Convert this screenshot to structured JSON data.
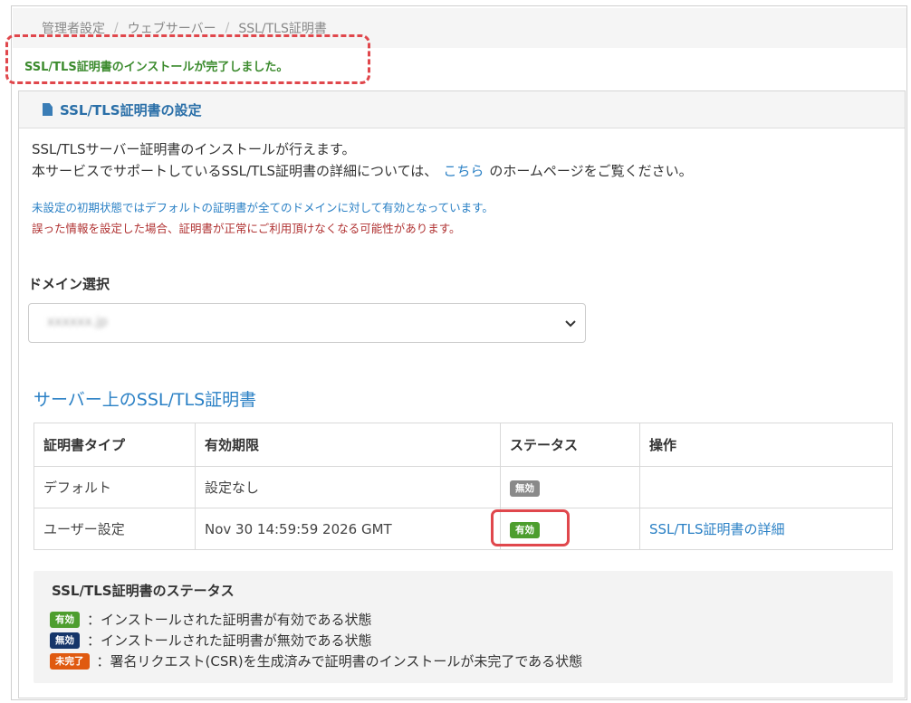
{
  "breadcrumb": [
    "管理者設定",
    "ウェブサーバー",
    "SSL/TLS証明書"
  ],
  "success_message": "SSL/TLS証明書のインストールが完了しました。",
  "panel": {
    "title": "SSL/TLS証明書の設定",
    "intro_line1": "SSL/TLSサーバー証明書のインストールが行えます。",
    "intro_line2_pre": "本サービスでサポートしているSSL/TLS証明書の詳細については、",
    "intro_link": "こちら",
    "intro_line2_post": "のホームページをご覧ください。",
    "note_info": "未設定の初期状態ではデフォルトの証明書が全てのドメインに対して有効となっています。",
    "note_warn": "誤った情報を設定した場合、証明書が正常にご利用頂けなくなる可能性があります。"
  },
  "domain": {
    "label": "ドメイン選択",
    "selected": "xxxxxx.jp"
  },
  "certs": {
    "title": "サーバー上のSSL/TLS証明書",
    "headers": [
      "証明書タイプ",
      "有効期限",
      "ステータス",
      "操作"
    ],
    "rows": [
      {
        "type": "デフォルト",
        "expires": "設定なし",
        "status": "無効",
        "action": ""
      },
      {
        "type": "ユーザー設定",
        "expires": "Nov 30 14:59:59 2026 GMT",
        "status": "有効",
        "action": "SSL/TLS証明書の詳細"
      }
    ]
  },
  "legend": {
    "title": "SSL/TLS証明書のステータス",
    "items": [
      {
        "badge": "有効",
        "text": "：インストールされた証明書が有効である状態",
        "color": "#4d9e2e"
      },
      {
        "badge": "無効",
        "text": "：インストールされた証明書が無効である状態",
        "color": "#16366a"
      },
      {
        "badge": "未完了",
        "text": "：署名リクエスト(CSR)を生成済みで証明書のインストールが未完了である状態",
        "color": "#e05a10"
      }
    ]
  },
  "colors": {
    "accent": "#2a80c5",
    "success": "#3c8b2e",
    "highlight": "#e0474c"
  }
}
